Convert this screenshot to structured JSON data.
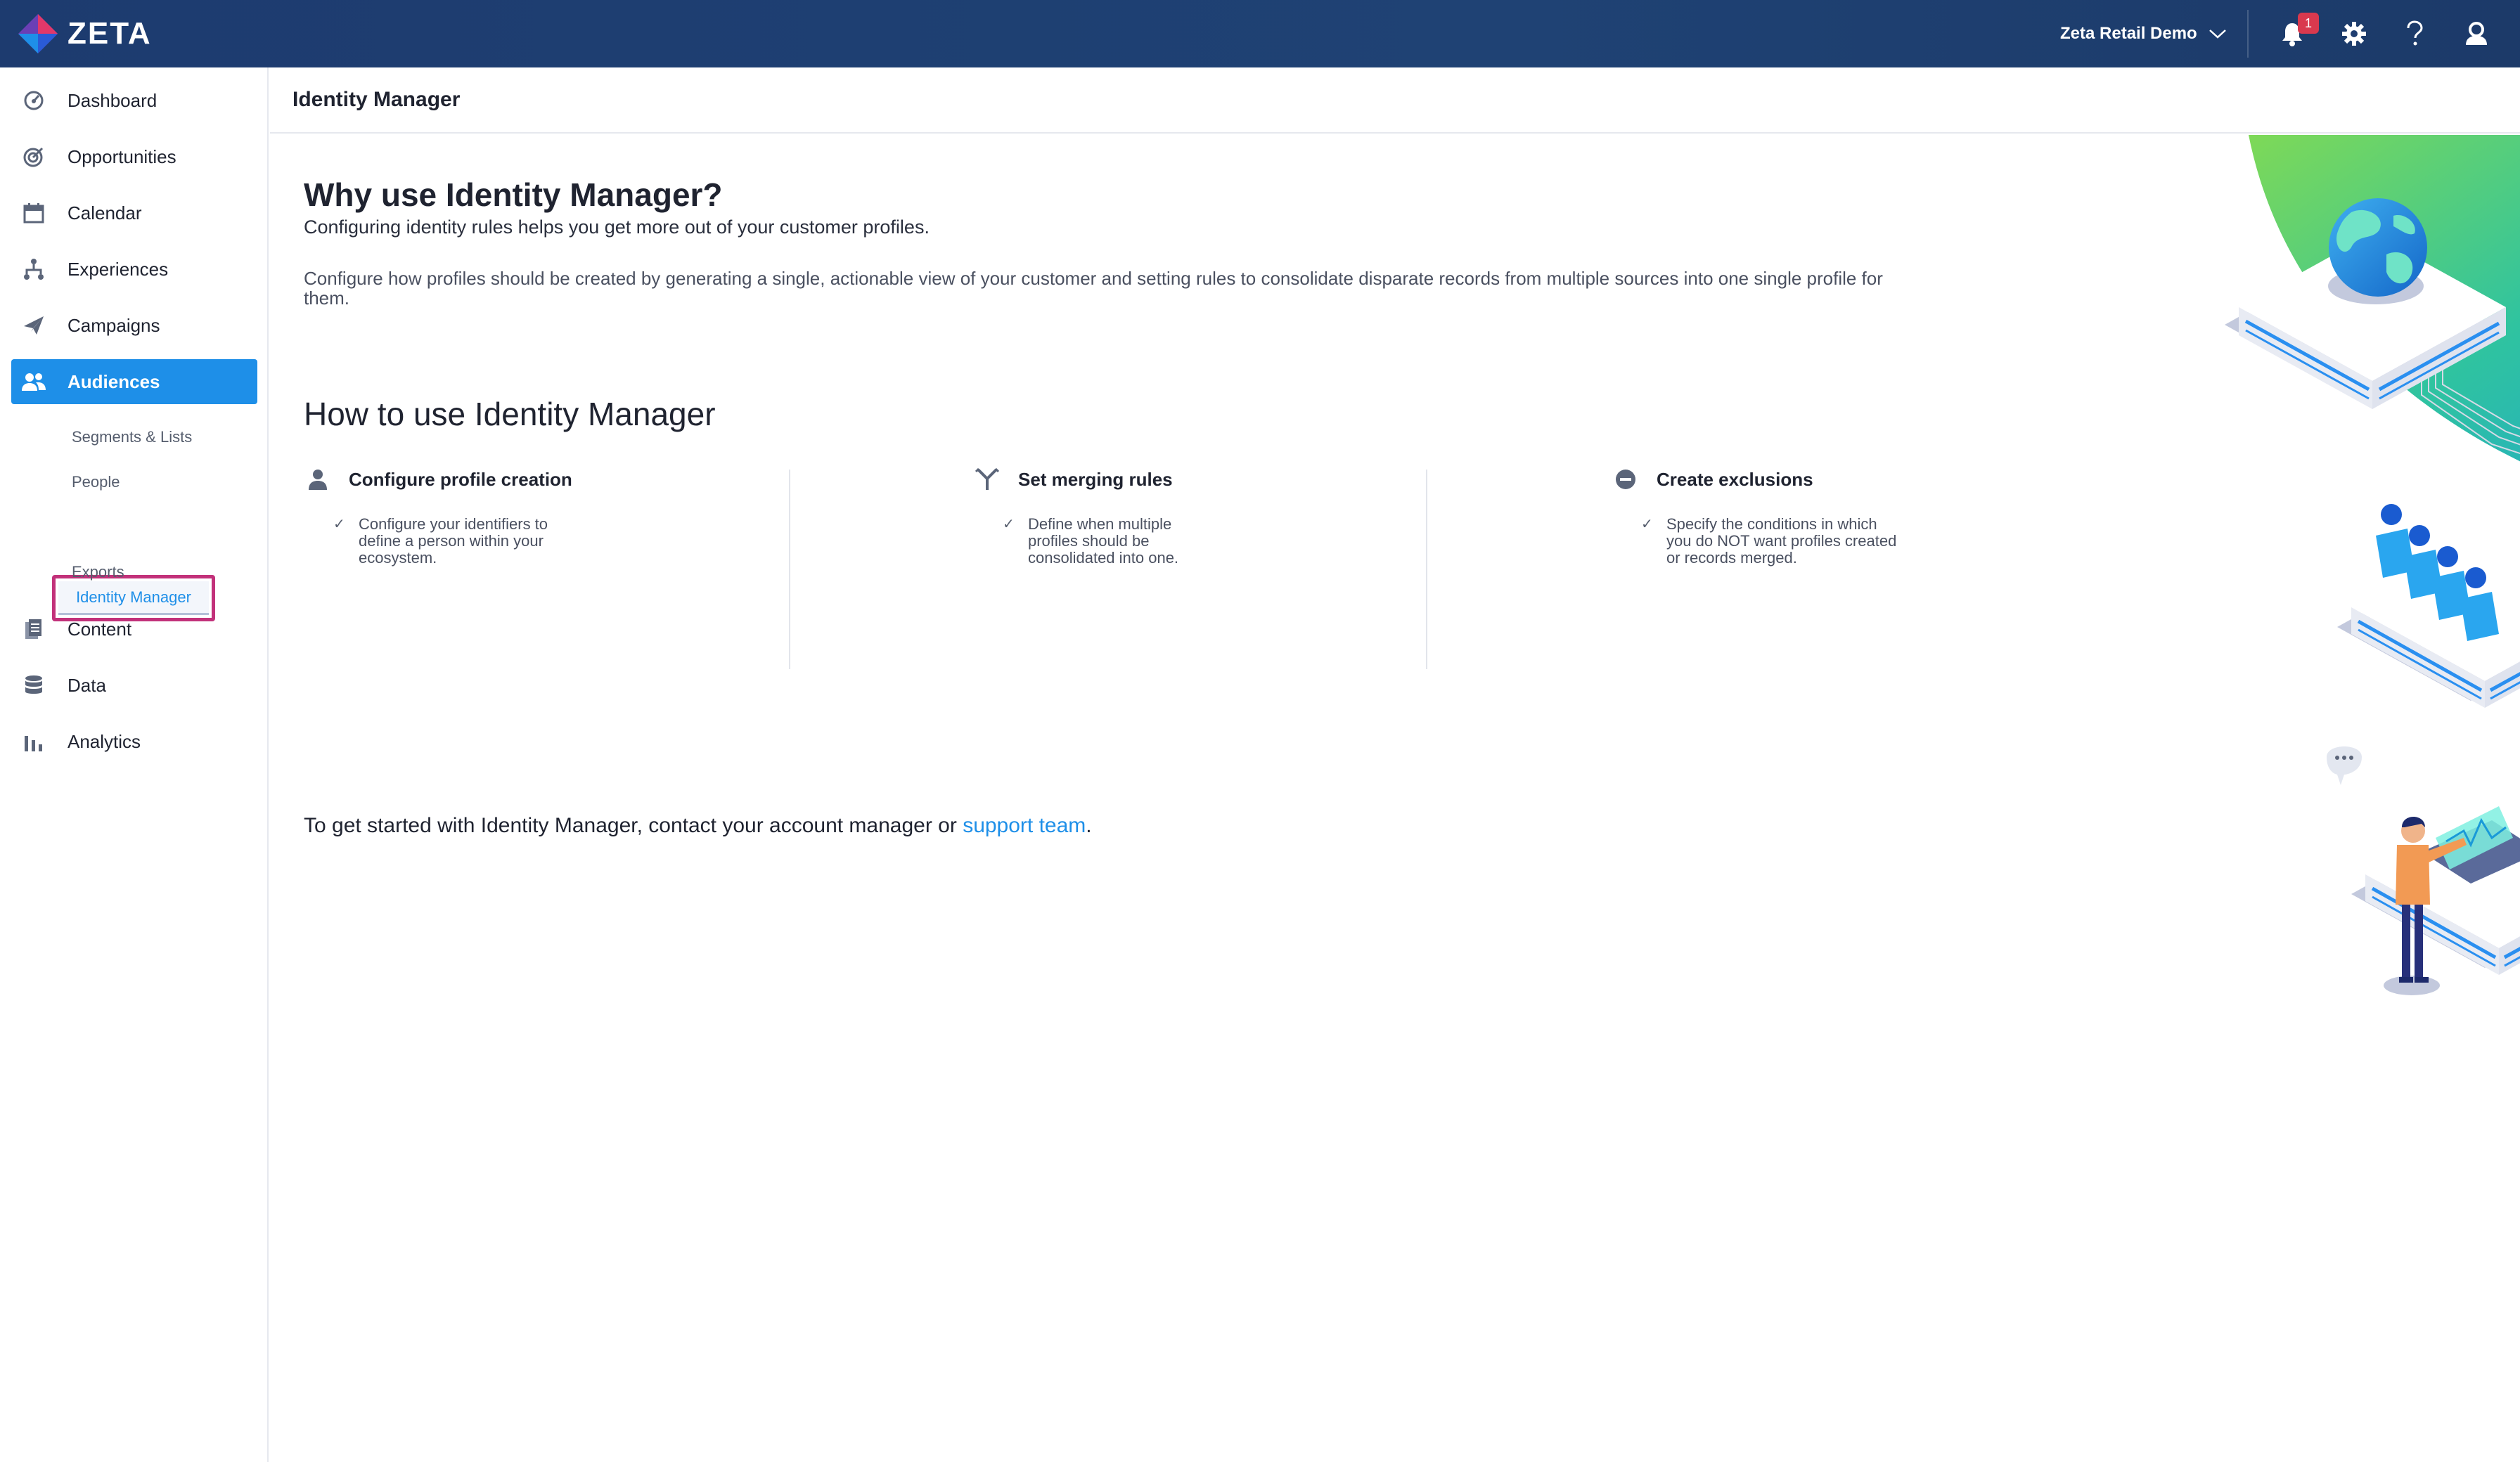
{
  "app": {
    "logo_text": "ZETA"
  },
  "topbar": {
    "account_name": "Zeta Retail Demo",
    "notification_count": "1",
    "icons": [
      "chevron-down-icon",
      "bell-icon",
      "gear-icon",
      "help-icon",
      "user-icon"
    ]
  },
  "sidebar": {
    "items": [
      {
        "label": "Dashboard",
        "icon": "dashboard-icon"
      },
      {
        "label": "Opportunities",
        "icon": "target-icon"
      },
      {
        "label": "Calendar",
        "icon": "calendar-icon"
      },
      {
        "label": "Experiences",
        "icon": "hierarchy-icon"
      },
      {
        "label": "Campaigns",
        "icon": "paper-plane-icon"
      },
      {
        "label": "Audiences",
        "icon": "people-icon",
        "active": true
      },
      {
        "label": "Content",
        "icon": "documents-icon"
      },
      {
        "label": "Data",
        "icon": "database-icon"
      },
      {
        "label": "Analytics",
        "icon": "bar-chart-icon"
      }
    ],
    "audiences_sub": [
      {
        "label": "Segments & Lists"
      },
      {
        "label": "People"
      },
      {
        "label": "Identity Manager",
        "active": true
      },
      {
        "label": "Exports"
      }
    ]
  },
  "header": {
    "title": "Identity Manager"
  },
  "main": {
    "why_title": "Why use Identity Manager?",
    "why_subtitle": "Configuring identity rules helps you get more out of your customer profiles.",
    "why_description": "Configure how profiles should be created by generating a single, actionable view of your customer and setting rules to consolidate disparate records from multiple sources into one single profile for them.",
    "how_title": "How to use Identity Manager",
    "steps": [
      {
        "title": "Configure profile creation",
        "icon": "person-icon",
        "text": "Configure your identifiers to define a person within your ecosystem."
      },
      {
        "title": "Set merging rules",
        "icon": "merge-icon",
        "text": "Define when multiple profiles should be consolidated into one."
      },
      {
        "title": "Create exclusions",
        "icon": "minus-circle-icon",
        "text": "Specify the conditions in which you do NOT want profiles created or records merged."
      }
    ],
    "get_started_text": "To get started with Identity Manager, contact your account manager or ",
    "support_link": "support team",
    "get_started_end": "."
  },
  "colors": {
    "topbar": "#1d3b6f",
    "accent": "#1e8fe8",
    "highlight_border": "#c2317a",
    "badge": "#d9394e"
  }
}
